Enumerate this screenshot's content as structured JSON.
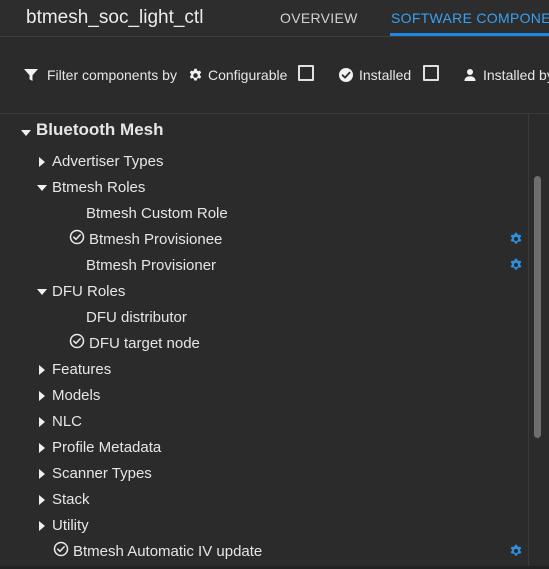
{
  "header": {
    "title": "btmesh_soc_light_ctl",
    "tabs": [
      {
        "label": "OVERVIEW"
      },
      {
        "label": "SOFTWARE COMPONE"
      }
    ]
  },
  "filters": {
    "label": "Filter components by",
    "configurable_label": "Configurable",
    "installed_label": "Installed",
    "installed_by_label": "Installed by"
  },
  "tree": {
    "root_label": "Bluetooth Mesh",
    "items": [
      {
        "label": "Advertiser Types"
      },
      {
        "label": "Btmesh Roles"
      },
      {
        "label": "Btmesh Custom Role"
      },
      {
        "label": "Btmesh Provisionee"
      },
      {
        "label": "Btmesh Provisioner"
      },
      {
        "label": "DFU Roles"
      },
      {
        "label": "DFU distributor"
      },
      {
        "label": "DFU target node"
      },
      {
        "label": "Features"
      },
      {
        "label": "Models"
      },
      {
        "label": "NLC"
      },
      {
        "label": "Profile Metadata"
      },
      {
        "label": "Scanner Types"
      },
      {
        "label": "Stack"
      },
      {
        "label": "Utility"
      },
      {
        "label": "Btmesh Automatic IV update"
      }
    ]
  },
  "colors": {
    "accent": "#1e88e5",
    "gear": "#2f8fe0"
  },
  "icons": {
    "filter": "filter-icon",
    "configurable": "gear-icon",
    "installed": "check-circle-icon",
    "installed_by": "person-icon",
    "caret_right": "caret-right-icon",
    "caret_down": "caret-down-icon"
  }
}
